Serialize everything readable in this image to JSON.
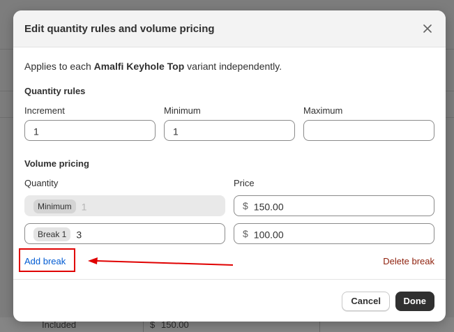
{
  "modal": {
    "title": "Edit quantity rules and volume pricing",
    "intro_prefix": "Applies to each ",
    "product_name": "Amalfi Keyhole Top",
    "intro_suffix": " variant independently."
  },
  "quantity_rules": {
    "heading": "Quantity rules",
    "increment_label": "Increment",
    "increment_value": "1",
    "minimum_label": "Minimum",
    "minimum_value": "1",
    "maximum_label": "Maximum",
    "maximum_value": ""
  },
  "volume_pricing": {
    "heading": "Volume pricing",
    "quantity_label": "Quantity",
    "price_label": "Price",
    "currency_symbol": "$",
    "rows": [
      {
        "chip": "Minimum",
        "quantity": "1",
        "price": "150.00"
      },
      {
        "chip": "Break 1",
        "quantity": "3",
        "price": "100.00"
      }
    ],
    "add_break_label": "Add break",
    "delete_break_label": "Delete break"
  },
  "footer": {
    "cancel_label": "Cancel",
    "done_label": "Done"
  },
  "background": {
    "row_label": "Included",
    "row_currency": "$",
    "row_price": "150.00"
  },
  "colors": {
    "link_blue": "#005bd3",
    "link_red": "#8e1f0b",
    "annotation_red": "#e00000",
    "primary_button": "#303030"
  }
}
